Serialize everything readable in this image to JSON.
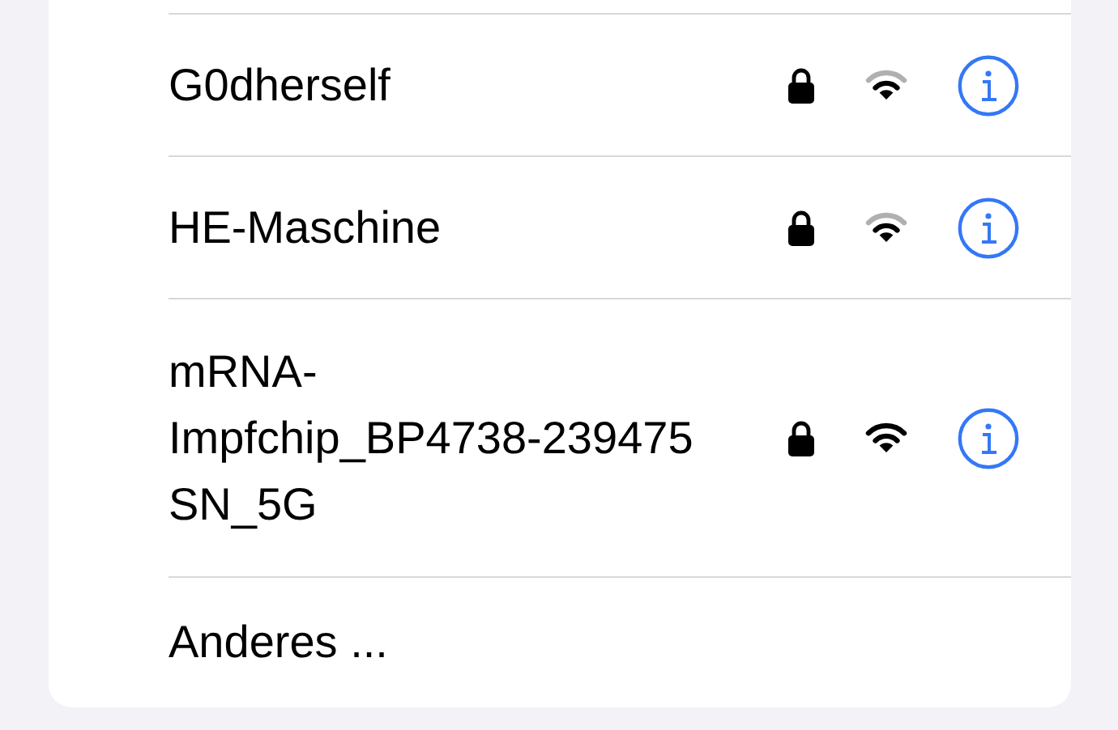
{
  "networks": [
    {
      "name": "G0dherself",
      "secured": true,
      "full_signal": false
    },
    {
      "name": "HE-Maschine",
      "secured": true,
      "full_signal": false
    },
    {
      "name": "mRNA-\nImpfchip_BP4738-239475\nSN_5G",
      "secured": true,
      "full_signal": true
    }
  ],
  "other": {
    "label": "Anderes ..."
  }
}
